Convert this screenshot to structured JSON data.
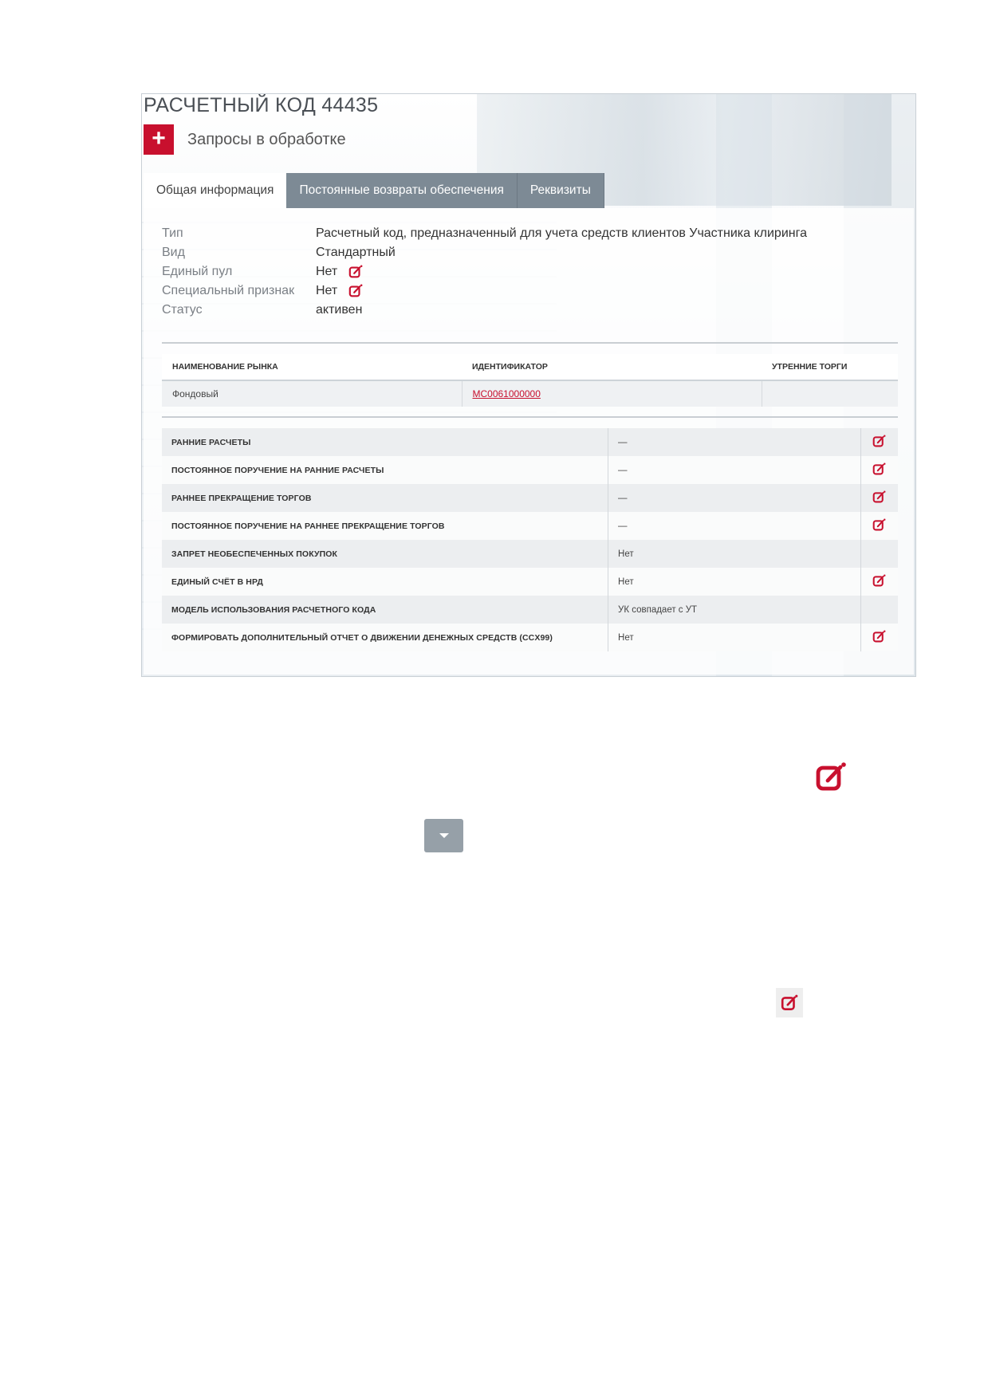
{
  "header": {
    "title": "РАСЧЕТНЫЙ КОД 44435",
    "requests_label": "Запросы в обработке",
    "plus_symbol": "+"
  },
  "tabs": [
    {
      "label": "Общая информация",
      "active": true
    },
    {
      "label": "Постоянные возвраты обеспечения",
      "active": false
    },
    {
      "label": "Реквизиты",
      "active": false
    }
  ],
  "info": [
    {
      "key": "Тип",
      "value": "Расчетный код, предназначенный для учета средств клиентов Участника клиринга",
      "editable": false
    },
    {
      "key": "Вид",
      "value": "Стандартный",
      "editable": false
    },
    {
      "key": "Единый пул",
      "value": "Нет",
      "editable": true
    },
    {
      "key": "Специальный признак",
      "value": "Нет",
      "editable": true
    },
    {
      "key": "Статус",
      "value": "активен",
      "editable": false
    }
  ],
  "markets": {
    "headers": [
      "НАИМЕНОВАНИЕ РЫНКА",
      "ИДЕНТИФИКАТОР",
      "УТРЕННИЕ ТОРГИ"
    ],
    "rows": [
      {
        "market": "Фондовый",
        "identifier": "MC0061000000",
        "morning": ""
      }
    ]
  },
  "settings": [
    {
      "label": "РАННИЕ РАСЧЕТЫ",
      "value": "—",
      "editable": true
    },
    {
      "label": "ПОСТОЯННОЕ ПОРУЧЕНИЕ НА РАННИЕ РАСЧЕТЫ",
      "value": "—",
      "editable": true
    },
    {
      "label": "РАННЕЕ ПРЕКРАЩЕНИЕ ТОРГОВ",
      "value": "—",
      "editable": true
    },
    {
      "label": "ПОСТОЯННОЕ ПОРУЧЕНИЕ НА РАННЕЕ ПРЕКРАЩЕНИЕ ТОРГОВ",
      "value": "—",
      "editable": true
    },
    {
      "label": "ЗАПРЕТ НЕОБЕСПЕЧЕННЫХ ПОКУПОК",
      "value": "Нет",
      "editable": false
    },
    {
      "label": "ЕДИНЫЙ СЧЁТ В НРД",
      "value": "Нет",
      "editable": true
    },
    {
      "label": "МОДЕЛЬ ИСПОЛЬЗОВАНИЯ РАСЧЕТНОГО КОДА",
      "value": "УК совпадает с УТ",
      "editable": false
    },
    {
      "label": "ФОРМИРОВАТЬ ДОПОЛНИТЕЛЬНЫЙ ОТЧЕТ О ДВИЖЕНИИ ДЕНЕЖНЫХ СРЕДСТВ (CCX99)",
      "value": "Нет",
      "editable": true
    }
  ],
  "icons": {
    "edit": "edit-icon",
    "dropdown": "caret-down-icon"
  },
  "colors": {
    "accent": "#c8102e",
    "tab_inactive": "#7d8a95",
    "dropdown_button": "#96a0a8"
  }
}
